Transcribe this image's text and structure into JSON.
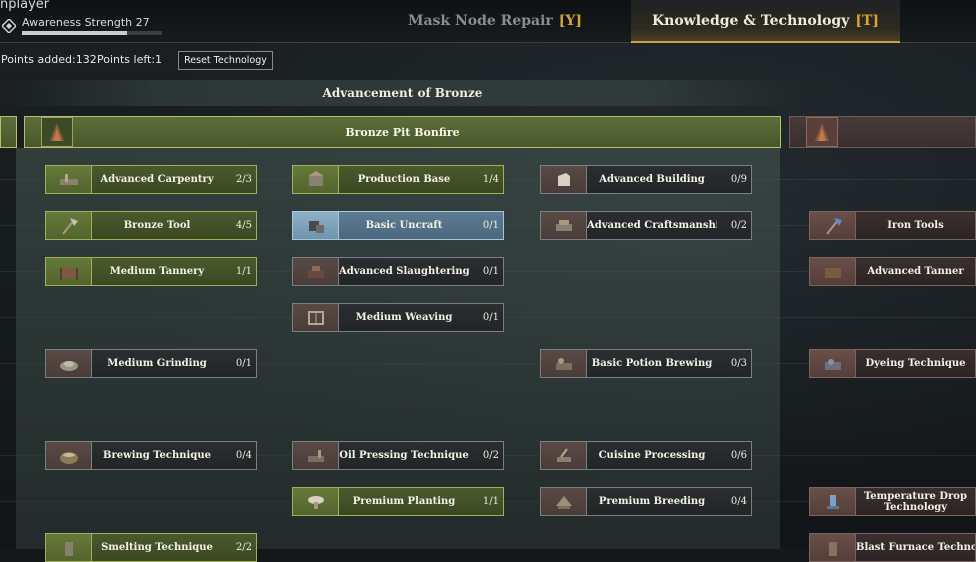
{
  "player": {
    "name": "nplayer",
    "awareness_label": "Awareness Strength 27",
    "awareness_progress": 0.75
  },
  "tabs": {
    "mask": {
      "label": "Mask Node Repair",
      "key": "[Y]"
    },
    "knowledge": {
      "label": "Knowledge & Technology",
      "key": "[T]"
    }
  },
  "points": {
    "added": "Points added:132",
    "left": "Points left:1",
    "reset_label": "Reset Technology"
  },
  "section": {
    "title": "Advancement of Bronze"
  },
  "banner": {
    "label": "Bronze Pit Bonfire"
  },
  "nodes": {
    "advanced_carpentry": {
      "label": "Advanced Carpentry",
      "count": "2/3"
    },
    "production_base": {
      "label": "Production Base",
      "count": "1/4"
    },
    "advanced_building": {
      "label": "Advanced Building",
      "count": "0/9"
    },
    "bronze_tool": {
      "label": "Bronze Tool",
      "count": "4/5"
    },
    "basic_uncraft": {
      "label": "Basic Uncraft",
      "count": "0/1"
    },
    "advanced_craftsmanship": {
      "label": "Advanced Craftsmanship",
      "count": "0/2"
    },
    "iron_tools": {
      "label": "Iron Tools",
      "count": ""
    },
    "medium_tannery": {
      "label": "Medium Tannery",
      "count": "1/1"
    },
    "advanced_slaughtering": {
      "label": "Advanced Slaughtering",
      "count": "0/1"
    },
    "advanced_tanner": {
      "label": "Advanced Tanner",
      "count": ""
    },
    "medium_weaving": {
      "label": "Medium Weaving",
      "count": "0/1"
    },
    "medium_grinding": {
      "label": "Medium Grinding",
      "count": "0/1"
    },
    "basic_potion_brewing": {
      "label": "Basic Potion Brewing",
      "count": "0/3"
    },
    "dyeing_technique": {
      "label": "Dyeing Technique",
      "count": ""
    },
    "brewing_technique": {
      "label": "Brewing Technique",
      "count": "0/4"
    },
    "oil_pressing_technique": {
      "label": "Oil Pressing Technique",
      "count": "0/2"
    },
    "cuisine_processing": {
      "label": "Cuisine Processing",
      "count": "0/6"
    },
    "premium_planting": {
      "label": "Premium Planting",
      "count": "1/1"
    },
    "premium_breeding": {
      "label": "Premium Breeding",
      "count": "0/4"
    },
    "temperature_drop": {
      "label": "Temperature Drop Technology",
      "count": ""
    },
    "smelting_technique": {
      "label": "Smelting Technique",
      "count": "2/2"
    },
    "blast_furnace": {
      "label": "Blast Furnace Technology",
      "count": ""
    }
  },
  "colors": {
    "unlocked": "#4a5a2c",
    "available": "#2b2e30",
    "selected": "#5c7c94",
    "locked": "#3a2f2f",
    "accent": "#d9a33c"
  }
}
